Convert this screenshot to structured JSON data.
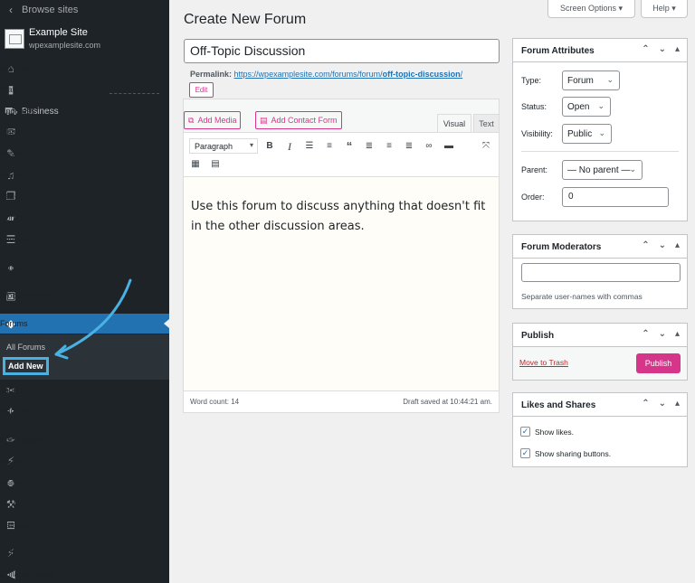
{
  "colors": {
    "sidebar_bg": "#1d2327",
    "active": "#2271b1",
    "accent": "#d63689",
    "annotation": "#4ab1e3"
  },
  "sidebar": {
    "back": {
      "icon": "chevron-left-icon",
      "label": "Browse sites"
    },
    "site": {
      "name": "Example Site",
      "url": "wpexamplesite.com"
    },
    "items": [
      {
        "icon": "home-icon",
        "label": "My Home"
      },
      {
        "icon": "stats-icon",
        "label": "Stats"
      },
      {
        "icon": "cart-icon",
        "label": "Upgrades",
        "extra": "Business"
      },
      {
        "icon": "inbox-icon",
        "label": "Inbox"
      },
      {
        "icon": "pin-icon",
        "label": "Posts"
      },
      {
        "icon": "media-icon",
        "label": "Media"
      },
      {
        "icon": "pages-icon",
        "label": "Pages"
      },
      {
        "icon": "comments-icon",
        "label": "Comments"
      },
      {
        "icon": "feedback-icon",
        "label": "Feedback"
      },
      {
        "icon": "jetpack-icon",
        "label": "Jetpack"
      },
      {
        "icon": "woocommerce-icon",
        "label": "WooCommerce"
      },
      {
        "icon": "forums-icon",
        "label": "Forums"
      },
      {
        "icon": "topics-icon",
        "label": "Topics"
      },
      {
        "icon": "replies-icon",
        "label": "Replies"
      },
      {
        "icon": "appearance-icon",
        "label": "Appearance"
      },
      {
        "icon": "plugins-icon",
        "label": "Plugins"
      },
      {
        "icon": "users-icon",
        "label": "Users"
      },
      {
        "icon": "tools-icon",
        "label": "Tools"
      },
      {
        "icon": "settings-icon",
        "label": "Settings"
      },
      {
        "icon": "amp-icon",
        "label": "AMP"
      },
      {
        "icon": "collapse-icon",
        "label": "Collapse menu"
      }
    ],
    "submenu": {
      "all": "All Forums",
      "add": "Add New"
    }
  },
  "top_buttons": {
    "screen_options": "Screen Options ▾",
    "help": "Help ▾"
  },
  "page": {
    "title": "Create New Forum",
    "post_title": "Off-Topic Discussion",
    "permalink_label": "Permalink:",
    "permalink_base": "https://wpexamplesite.com/forums/forum/",
    "permalink_slug": "off-topic-discussion",
    "permalink_end": "/",
    "edit_label": "Edit"
  },
  "editor": {
    "add_media": "Add Media",
    "add_contact_form": "Add Contact Form",
    "tab_visual": "Visual",
    "tab_text": "Text",
    "format": "Paragraph",
    "content": "Use this forum to discuss anything that doesn't fit in the other discussion areas.",
    "word_count": "Word count: 14",
    "draft_saved": "Draft saved at 10:44:21 am."
  },
  "forum_attributes": {
    "title": "Forum Attributes",
    "type_label": "Type:",
    "type_value": "Forum",
    "status_label": "Status:",
    "status_value": "Open",
    "visibility_label": "Visibility:",
    "visibility_value": "Public",
    "parent_label": "Parent:",
    "parent_value": "— No parent —",
    "order_label": "Order:",
    "order_value": "0"
  },
  "forum_moderators": {
    "title": "Forum Moderators",
    "hint": "Separate user-names with commas"
  },
  "publish": {
    "title": "Publish",
    "trash": "Move to Trash",
    "button": "Publish"
  },
  "likes": {
    "title": "Likes and Shares",
    "show_likes": "Show likes.",
    "show_sharing": "Show sharing buttons."
  }
}
